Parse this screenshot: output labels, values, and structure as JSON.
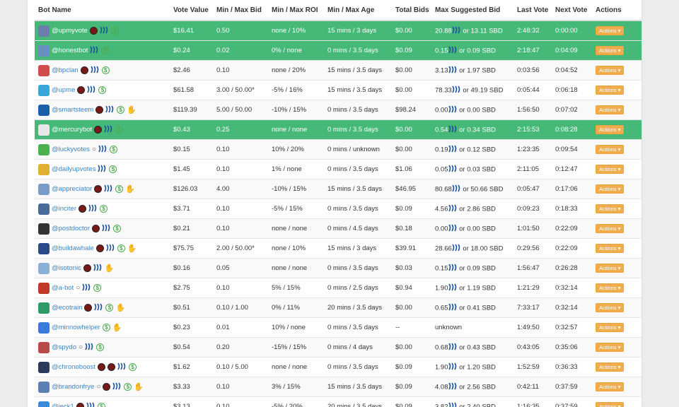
{
  "headers": [
    "Bot Name",
    "Vote Value",
    "Min / Max Bid",
    "Min / Max ROI",
    "Min / Max Age",
    "Total Bids",
    "Max Suggested Bid",
    "Last Vote",
    "Next Vote",
    "Actions"
  ],
  "action_label": "Actions ▾",
  "colors": {
    "highlight": "#46b978",
    "accent": "#f0ad4e",
    "link": "#3a86c8"
  },
  "rows": [
    {
      "name": "@upmyvote",
      "avatar": "#6b7fa8",
      "highlight": true,
      "icons": [
        "badge",
        "steem",
        "dollar"
      ],
      "vote": "$16.41",
      "bid": "0.50",
      "roi": "none / 10%",
      "age": "15 mins / 3 days",
      "total": "$0.00",
      "sugg_a": "20.88",
      "sugg_b": "or 13.11 SBD",
      "last": "2:48:32",
      "next": "0:00:00"
    },
    {
      "name": "@honestbot",
      "avatar": "#6a8fc2",
      "highlight": true,
      "icons": [
        "steem",
        "dollar"
      ],
      "vote": "$0.24",
      "bid": "0.02",
      "roi": "0% / none",
      "age": "0 mins / 3.5 days",
      "total": "$0.09",
      "sugg_a": "0.15",
      "sugg_b": "or 0.09 SBD",
      "last": "2:18:47",
      "next": "0:04:09"
    },
    {
      "name": "@bpclan",
      "avatar": "#d04c4c",
      "highlight": false,
      "icons": [
        "badge",
        "steem",
        "dollar"
      ],
      "vote": "$2.46",
      "bid": "0.10",
      "roi": "none / 20%",
      "age": "15 mins / 3.5 days",
      "total": "$0.00",
      "sugg_a": "3.13",
      "sugg_b": "or 1.97 SBD",
      "last": "0:03:56",
      "next": "0:04:52"
    },
    {
      "name": "@upme",
      "avatar": "#3aa6d8",
      "highlight": false,
      "icons": [
        "badge",
        "steem",
        "dollar"
      ],
      "vote": "$61.58",
      "bid": "3.00 / 50.00*",
      "roi": "-5% / 16%",
      "age": "15 mins / 3.5 days",
      "total": "$0.00",
      "sugg_a": "78.33",
      "sugg_b": "or 49.19 SBD",
      "last": "0:05:44",
      "next": "0:06:18"
    },
    {
      "name": "@smartsteem",
      "avatar": "#1b5fa8",
      "highlight": false,
      "icons": [
        "badge",
        "steem",
        "dollar",
        "hand"
      ],
      "vote": "$119.39",
      "bid": "5.00 / 50.00",
      "roi": "-10% / 15%",
      "age": "0 mins / 3.5 days",
      "total": "$98.24",
      "sugg_a": "0.00",
      "sugg_b": "or 0.00 SBD",
      "last": "1:56:50",
      "next": "0:07:02"
    },
    {
      "name": "@mercurybot",
      "avatar": "#e8e8e8",
      "highlight": true,
      "icons": [
        "badge",
        "steem",
        "dollar"
      ],
      "vote": "$0.43",
      "bid": "0.25",
      "roi": "none / none",
      "age": "0 mins / 3.5 days",
      "total": "$0.00",
      "sugg_a": "0.54",
      "sugg_b": "or 0.34 SBD",
      "last": "2:15:53",
      "next": "0:08:28"
    },
    {
      "name": "@luckyvotes",
      "avatar": "#4caf50",
      "highlight": false,
      "icons": [
        "bubble",
        "steem",
        "dollar"
      ],
      "vote": "$0.15",
      "bid": "0.10",
      "roi": "10% / 20%",
      "age": "0 mins / unknown",
      "total": "$0.00",
      "sugg_a": "0.19",
      "sugg_b": "or 0.12 SBD",
      "last": "1:23:35",
      "next": "0:09:54"
    },
    {
      "name": "@dailyupvotes",
      "avatar": "#e0b030",
      "highlight": false,
      "icons": [
        "steem",
        "dollar"
      ],
      "vote": "$1.45",
      "bid": "0.10",
      "roi": "1% / none",
      "age": "0 mins / 3.5 days",
      "total": "$1.06",
      "sugg_a": "0.05",
      "sugg_b": "or 0.03 SBD",
      "last": "2:11:05",
      "next": "0:12:47"
    },
    {
      "name": "@appreciator",
      "avatar": "#7a9cc8",
      "highlight": false,
      "icons": [
        "badge",
        "steem",
        "dollar",
        "hand"
      ],
      "vote": "$126.03",
      "bid": "4.00",
      "roi": "-10% / 15%",
      "age": "15 mins / 3.5 days",
      "total": "$46.95",
      "sugg_a": "80.68",
      "sugg_b": "or 50.66 SBD",
      "last": "0:05:47",
      "next": "0:17:06"
    },
    {
      "name": "@inciter",
      "avatar": "#4a6a9a",
      "highlight": false,
      "icons": [
        "badge",
        "steem",
        "dollar"
      ],
      "vote": "$3.71",
      "bid": "0.10",
      "roi": "-5% / 15%",
      "age": "0 mins / 3.5 days",
      "total": "$0.09",
      "sugg_a": "4.56",
      "sugg_b": "or 2.86 SBD",
      "last": "0:09:23",
      "next": "0:18:33"
    },
    {
      "name": "@postdoctor",
      "avatar": "#333333",
      "highlight": false,
      "icons": [
        "badge",
        "steem",
        "dollar"
      ],
      "vote": "$0.21",
      "bid": "0.10",
      "roi": "none / none",
      "age": "0 mins / 4.5 days",
      "total": "$0.18",
      "sugg_a": "0.00",
      "sugg_b": "or 0.00 SBD",
      "last": "1:01:50",
      "next": "0:22:09"
    },
    {
      "name": "@buildawhale",
      "avatar": "#2c4a8a",
      "highlight": false,
      "icons": [
        "badge",
        "steem",
        "dollar",
        "hand"
      ],
      "vote": "$75.75",
      "bid": "2.00 / 50.00*",
      "roi": "none / 10%",
      "age": "15 mins / 3 days",
      "total": "$39.91",
      "sugg_a": "28.66",
      "sugg_b": "or 18.00 SBD",
      "last": "0:29:56",
      "next": "0:22:09"
    },
    {
      "name": "@isotonic",
      "avatar": "#8ab0d8",
      "highlight": false,
      "icons": [
        "badge",
        "steem",
        "hand"
      ],
      "vote": "$0.16",
      "bid": "0.05",
      "roi": "none / none",
      "age": "0 mins / 3.5 days",
      "total": "$0.03",
      "sugg_a": "0.15",
      "sugg_b": "or 0.09 SBD",
      "last": "1:56:47",
      "next": "0:26:28"
    },
    {
      "name": "@a-bot",
      "avatar": "#c0392b",
      "highlight": false,
      "icons": [
        "bubble",
        "steem",
        "dollar"
      ],
      "vote": "$2.75",
      "bid": "0.10",
      "roi": "5% / 15%",
      "age": "0 mins / 2.5 days",
      "total": "$0.94",
      "sugg_a": "1.90",
      "sugg_b": "or 1.19 SBD",
      "last": "1:21:29",
      "next": "0:32:14"
    },
    {
      "name": "@ecotrain",
      "avatar": "#2e9a6a",
      "highlight": false,
      "icons": [
        "badge",
        "steem",
        "dollar",
        "hand"
      ],
      "vote": "$0.51",
      "bid": "0.10 / 1.00",
      "roi": "0% / 11%",
      "age": "20 mins / 3.5 days",
      "total": "$0.00",
      "sugg_a": "0.65",
      "sugg_b": "or 0.41 SBD",
      "last": "7:33:17",
      "next": "0:32:14"
    },
    {
      "name": "@minnowhelper",
      "avatar": "#3a7ad8",
      "highlight": false,
      "icons": [
        "dollar",
        "hand"
      ],
      "vote": "$0.23",
      "bid": "0.01",
      "roi": "10% / none",
      "age": "0 mins / 3.5 days",
      "total": "--",
      "sugg_a": "unknown",
      "sugg_b": "",
      "last": "1:49:50",
      "next": "0:32:57"
    },
    {
      "name": "@spydo",
      "avatar": "#b84a4a",
      "highlight": false,
      "icons": [
        "bubble",
        "steem",
        "dollar"
      ],
      "vote": "$0.54",
      "bid": "0.20",
      "roi": "-15% / 15%",
      "age": "0 mins / 4 days",
      "total": "$0.00",
      "sugg_a": "0.68",
      "sugg_b": "or 0.43 SBD",
      "last": "0:43:05",
      "next": "0:35:06"
    },
    {
      "name": "@chronoboost",
      "avatar": "#2a3a5a",
      "highlight": false,
      "icons": [
        "badge",
        "badge",
        "steem",
        "dollar"
      ],
      "vote": "$1.62",
      "bid": "0.10 / 5.00",
      "roi": "none / none",
      "age": "0 mins / 3.5 days",
      "total": "$0.09",
      "sugg_a": "1.90",
      "sugg_b": "or 1.20 SBD",
      "last": "1:52:59",
      "next": "0:36:33"
    },
    {
      "name": "@brandonfrye",
      "avatar": "#5a7fb0",
      "highlight": false,
      "icons": [
        "bubble",
        "badge",
        "steem",
        "dollar",
        "hand"
      ],
      "vote": "$3.33",
      "bid": "0.10",
      "roi": "3% / 15%",
      "age": "15 mins / 3.5 days",
      "total": "$0.09",
      "sugg_a": "4.08",
      "sugg_b": "or 2.56 SBD",
      "last": "0:42:11",
      "next": "0:37:59"
    },
    {
      "name": "@jeck1",
      "avatar": "#3a8ad8",
      "highlight": false,
      "icons": [
        "badge",
        "steem",
        "dollar"
      ],
      "vote": "$3.13",
      "bid": "0.10",
      "roi": "-5% / 20%",
      "age": "20 mins / 3.5 days",
      "total": "$0.09",
      "sugg_a": "3.82",
      "sugg_b": "or 2.40 SBD",
      "last": "1:16:35",
      "next": "0:37:59"
    }
  ]
}
